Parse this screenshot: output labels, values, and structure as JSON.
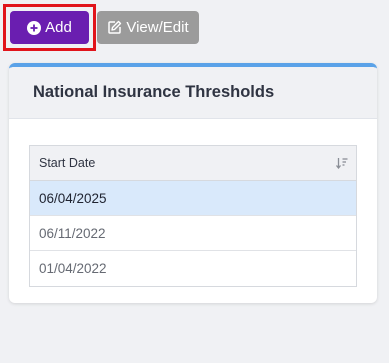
{
  "toolbar": {
    "add_label": "Add",
    "view_edit_label": "View/Edit"
  },
  "card": {
    "title": "National Insurance Thresholds"
  },
  "table": {
    "column_header": "Start Date",
    "rows": [
      {
        "start_date": "06/04/2025",
        "selected": true
      },
      {
        "start_date": "06/11/2022",
        "selected": false
      },
      {
        "start_date": "01/04/2022",
        "selected": false
      }
    ]
  },
  "colors": {
    "add_button": "#6a1eb0",
    "view_edit_button": "#9b9b9b",
    "highlight_border": "#e1141b",
    "card_accent": "#5aa2e8",
    "selected_row": "#d9e9fb"
  },
  "icons": {
    "add": "plus-circle-icon",
    "view_edit": "edit-icon",
    "sort": "sort-desc-icon"
  }
}
